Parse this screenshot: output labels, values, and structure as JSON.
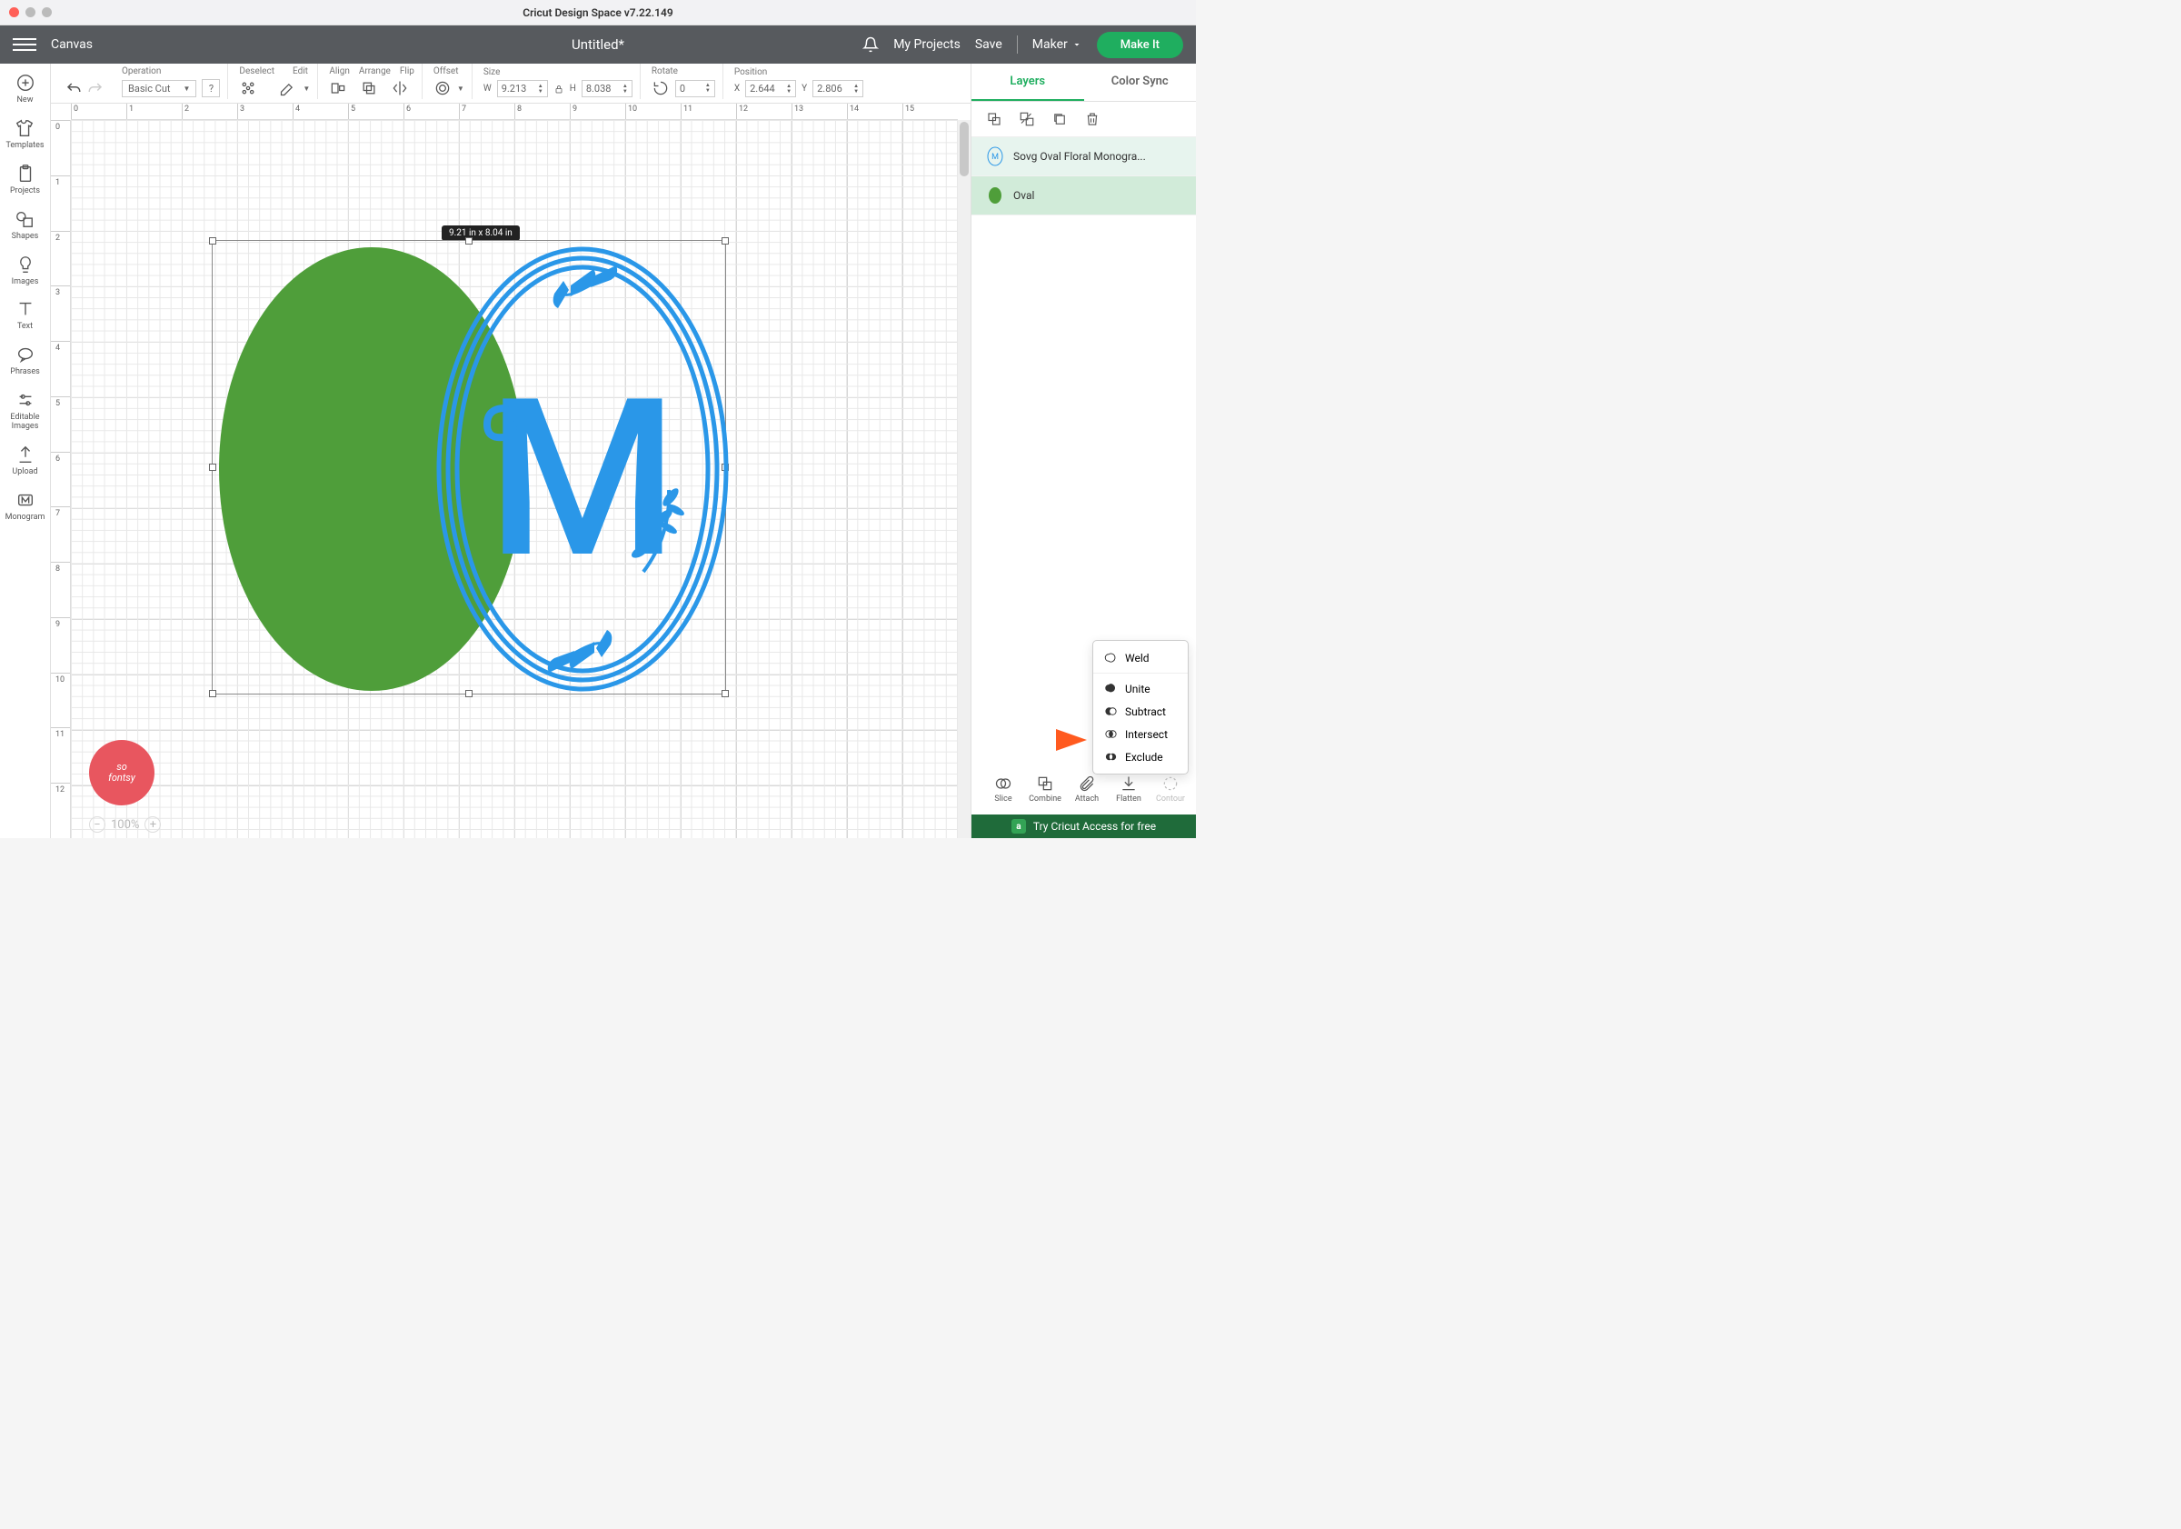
{
  "window": {
    "title": "Cricut Design Space  v7.22.149"
  },
  "topbar": {
    "canvas": "Canvas",
    "doc_title": "Untitled*",
    "my_projects": "My Projects",
    "save": "Save",
    "machine": "Maker",
    "make_it": "Make It"
  },
  "leftbar": {
    "new": "New",
    "templates": "Templates",
    "projects": "Projects",
    "shapes": "Shapes",
    "images": "Images",
    "text": "Text",
    "phrases": "Phrases",
    "editable_images": "Editable\nImages",
    "upload": "Upload",
    "monogram": "Monogram"
  },
  "toolbar": {
    "operation_lbl": "Operation",
    "operation_val": "Basic Cut",
    "deselect": "Deselect",
    "edit": "Edit",
    "align": "Align",
    "arrange": "Arrange",
    "flip": "Flip",
    "offset": "Offset",
    "size": "Size",
    "w": "W",
    "w_val": "9.213",
    "h": "H",
    "h_val": "8.038",
    "rotate": "Rotate",
    "rotate_val": "0",
    "position": "Position",
    "x": "X",
    "x_val": "2.644",
    "y": "Y",
    "y_val": "2.806"
  },
  "ruler_h": [
    "0",
    "1",
    "2",
    "3",
    "4",
    "5",
    "6",
    "7",
    "8",
    "9",
    "10",
    "11",
    "12",
    "13",
    "14",
    "15"
  ],
  "ruler_v": [
    "0",
    "1",
    "2",
    "3",
    "4",
    "5",
    "6",
    "7",
    "8",
    "9",
    "10",
    "11",
    "12"
  ],
  "selection": {
    "badge": "9.21  in x 8.04  in"
  },
  "zoom": "100%",
  "logo": "so\nfontsy",
  "layers_panel": {
    "tab_layers": "Layers",
    "tab_color_sync": "Color Sync",
    "items": [
      {
        "label": "Sovg Oval Floral Monogra..."
      },
      {
        "label": "Oval"
      }
    ]
  },
  "combine_menu": {
    "weld": "Weld",
    "unite": "Unite",
    "subtract": "Subtract",
    "intersect": "Intersect",
    "exclude": "Exclude"
  },
  "bottom_actions": {
    "slice": "Slice",
    "combine": "Combine",
    "attach": "Attach",
    "flatten": "Flatten",
    "contour": "Contour"
  },
  "promo": {
    "a": "a",
    "text": "Try Cricut Access for free"
  }
}
